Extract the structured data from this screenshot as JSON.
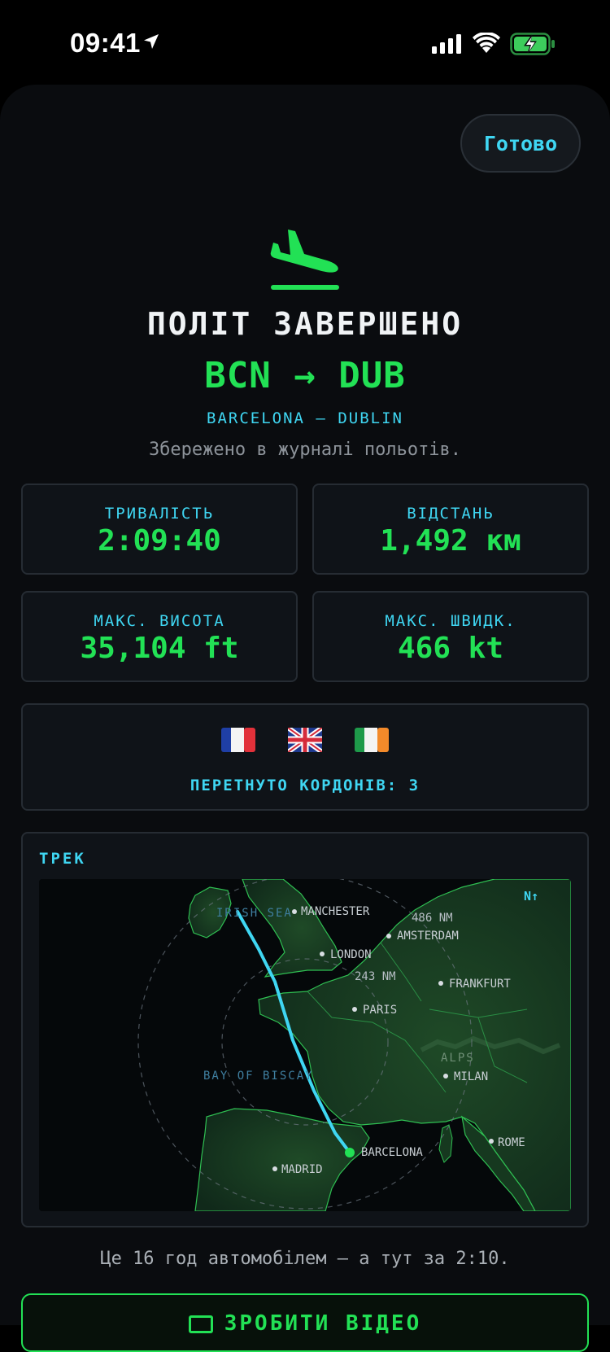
{
  "status": {
    "time": "09:41"
  },
  "header": {
    "done_label": "Готово"
  },
  "summary": {
    "title": "ПОЛІТ ЗАВЕРШЕНО",
    "route": "BCN → DUB",
    "cities": "BARCELONA — DUBLIN",
    "saved_note": "Збережено в журналі польотів."
  },
  "stats": [
    {
      "label": "ТРИВАЛІСТЬ",
      "value": "2:09:40"
    },
    {
      "label": "ВІДСТАНЬ",
      "value": "1,492 км"
    },
    {
      "label": "МАКС. ВИСОТА",
      "value": "35,104 ft"
    },
    {
      "label": "МАКС. ШВИДК.",
      "value": "466 kt"
    }
  ],
  "borders": {
    "flags": [
      "flag-france-icon",
      "flag-uk-icon",
      "flag-ireland-icon"
    ],
    "label": "ПЕРЕТНУТО КОРДОНІВ: 3"
  },
  "track": {
    "label": "ТРЕК",
    "north": "N↑",
    "places": {
      "irish_sea": "IRISH SEA",
      "manchester": "MANCHESTER",
      "amsterdam": "AMSTERDAM",
      "london": "LONDON",
      "frankfurt": "FRANKFURT",
      "paris": "PARIS",
      "alps": "ALPS",
      "milan": "MILAN",
      "bay": "BAY OF BISCAY",
      "barcelona": "BARCELONA",
      "rome": "ROME",
      "madrid": "MADRID"
    },
    "rings": [
      "486 NM",
      "243 NM"
    ]
  },
  "caption": "Це 16 год автомобілем — а тут за 2:10.",
  "share_label": "ЗРОБИТИ ВІДЕО",
  "colors": {
    "accent_green": "#22e155",
    "accent_cyan": "#3fd6f2",
    "background": "#0a0c0f"
  }
}
